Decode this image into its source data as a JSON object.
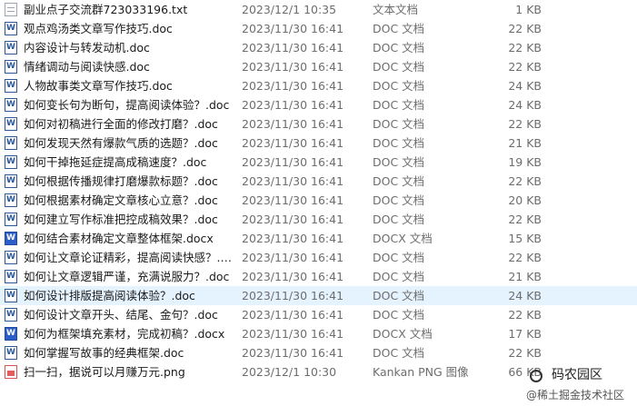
{
  "files": [
    {
      "name": "副业点子交流群723033196.txt",
      "date": "2023/12/1 10:35",
      "type": "文本文档",
      "size": "1 KB",
      "icon": "txt-file-icon"
    },
    {
      "name": "观点鸡汤类文章写作技巧.doc",
      "date": "2023/11/30 16:41",
      "type": "DOC 文档",
      "size": "22 KB",
      "icon": "doc-file-icon"
    },
    {
      "name": "内容设计与转发动机.doc",
      "date": "2023/11/30 16:41",
      "type": "DOC 文档",
      "size": "22 KB",
      "icon": "doc-file-icon"
    },
    {
      "name": "情绪调动与阅读快感.doc",
      "date": "2023/11/30 16:41",
      "type": "DOC 文档",
      "size": "22 KB",
      "icon": "doc-file-icon"
    },
    {
      "name": "人物故事类文章写作技巧.doc",
      "date": "2023/11/30 16:41",
      "type": "DOC 文档",
      "size": "24 KB",
      "icon": "doc-file-icon"
    },
    {
      "name": "如何变长句为断句，提高阅读体验？.doc",
      "date": "2023/11/30 16:41",
      "type": "DOC 文档",
      "size": "24 KB",
      "icon": "doc-file-icon"
    },
    {
      "name": "如何对初稿进行全面的修改打磨？.doc",
      "date": "2023/11/30 16:41",
      "type": "DOC 文档",
      "size": "22 KB",
      "icon": "doc-file-icon"
    },
    {
      "name": "如何发现天然有爆款气质的选题？.doc",
      "date": "2023/11/30 16:41",
      "type": "DOC 文档",
      "size": "21 KB",
      "icon": "doc-file-icon"
    },
    {
      "name": "如何干掉拖延症提高成稿速度？.doc",
      "date": "2023/11/30 16:41",
      "type": "DOC 文档",
      "size": "19 KB",
      "icon": "doc-file-icon"
    },
    {
      "name": "如何根据传播规律打磨爆款标题？.doc",
      "date": "2023/11/30 16:41",
      "type": "DOC 文档",
      "size": "22 KB",
      "icon": "doc-file-icon"
    },
    {
      "name": "如何根据素材确定文章核心立意？.doc",
      "date": "2023/11/30 16:41",
      "type": "DOC 文档",
      "size": "20 KB",
      "icon": "doc-file-icon"
    },
    {
      "name": "如何建立写作标准把控成稿效果？.doc",
      "date": "2023/11/30 16:41",
      "type": "DOC 文档",
      "size": "22 KB",
      "icon": "doc-file-icon"
    },
    {
      "name": "如何结合素材确定文章整体框架.docx",
      "date": "2023/11/30 16:41",
      "type": "DOCX 文档",
      "size": "15 KB",
      "icon": "docx-file-icon"
    },
    {
      "name": "如何让文章论证精彩，提高阅读快感？.doc",
      "date": "2023/11/30 16:41",
      "type": "DOC 文档",
      "size": "22 KB",
      "icon": "doc-file-icon"
    },
    {
      "name": "如何让文章逻辑严谨，充满说服力？.doc",
      "date": "2023/11/30 16:41",
      "type": "DOC 文档",
      "size": "21 KB",
      "icon": "doc-file-icon"
    },
    {
      "name": "如何设计排版提高阅读体验？.doc",
      "date": "2023/11/30 16:41",
      "type": "DOC 文档",
      "size": "24 KB",
      "icon": "doc-file-icon"
    },
    {
      "name": "如何设计文章开头、结尾、金句？.doc",
      "date": "2023/11/30 16:41",
      "type": "DOC 文档",
      "size": "22 KB",
      "icon": "doc-file-icon"
    },
    {
      "name": "如何为框架填充素材，完成初稿？.docx",
      "date": "2023/11/30 16:41",
      "type": "DOCX 文档",
      "size": "17 KB",
      "icon": "docx-file-icon"
    },
    {
      "name": "如何掌握写故事的经典框架.doc",
      "date": "2023/11/30 16:41",
      "type": "DOC 文档",
      "size": "22 KB",
      "icon": "doc-file-icon"
    },
    {
      "name": "扫一扫，据说可以月赚万元.png",
      "date": "2023/12/1 10:30",
      "type": "Kankan PNG 图像",
      "size": "66 KB",
      "icon": "png-file-icon"
    }
  ],
  "watermark": {
    "title": "码农园区",
    "subtitle": "@稀土掘金技术社区"
  }
}
